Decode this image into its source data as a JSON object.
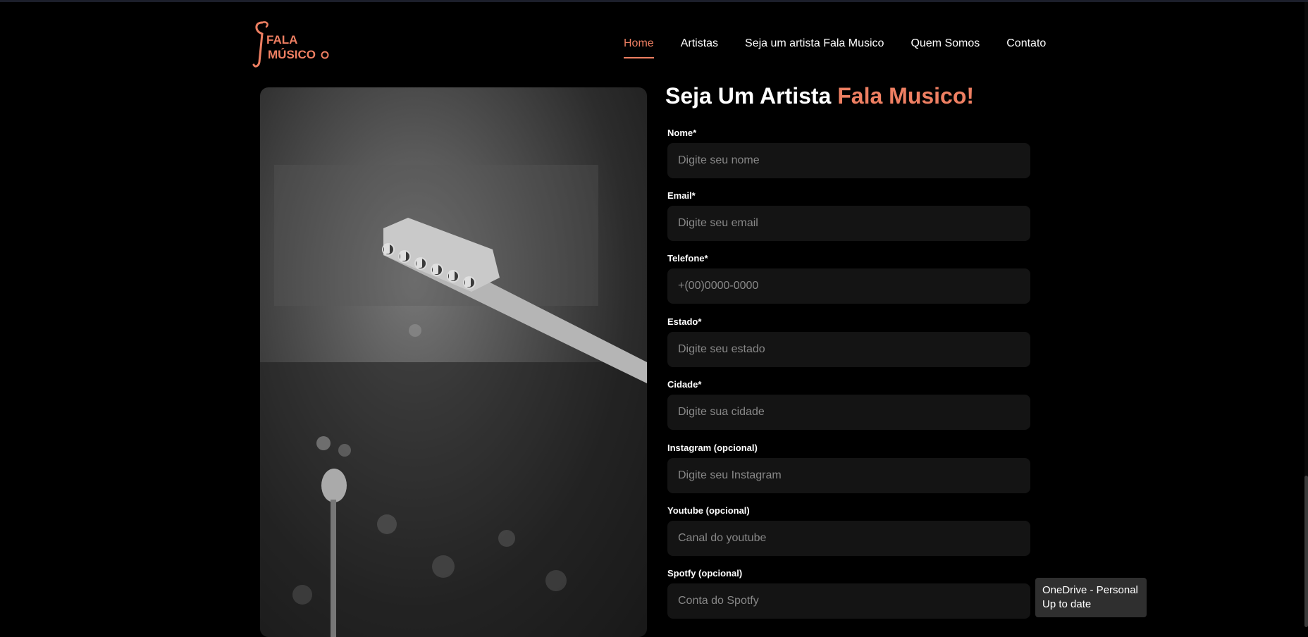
{
  "brand": {
    "logo_line1": "FALA",
    "logo_line2": "MÚSICO",
    "accent_color": "#ee7f62"
  },
  "nav": {
    "items": [
      {
        "label": "Home",
        "active": true
      },
      {
        "label": "Artistas"
      },
      {
        "label": "Seja um artista Fala Musico"
      },
      {
        "label": "Quem Somos"
      },
      {
        "label": "Contato"
      }
    ]
  },
  "form": {
    "title_main": "Seja Um Artista ",
    "title_accent": "Fala Musico!",
    "fields": [
      {
        "label": "Nome*",
        "placeholder": "Digite seu nome"
      },
      {
        "label": "Email*",
        "placeholder": "Digite seu email"
      },
      {
        "label": "Telefone*",
        "placeholder": "+(00)0000-0000"
      },
      {
        "label": "Estado*",
        "placeholder": "Digite seu estado"
      },
      {
        "label": "Cidade*",
        "placeholder": "Digite sua cidade"
      },
      {
        "label": "Instagram (opcional)",
        "placeholder": "Digite seu Instagram"
      },
      {
        "label": "Youtube (opcional)",
        "placeholder": "Canal do youtube"
      },
      {
        "label": "Spotfy (opcional)",
        "placeholder": "Conta do Spotfy"
      }
    ]
  },
  "photo": {
    "icon": "guitar-headstock-photo"
  },
  "toast": {
    "line1": "OneDrive - Personal",
    "line2": "Up to date"
  }
}
